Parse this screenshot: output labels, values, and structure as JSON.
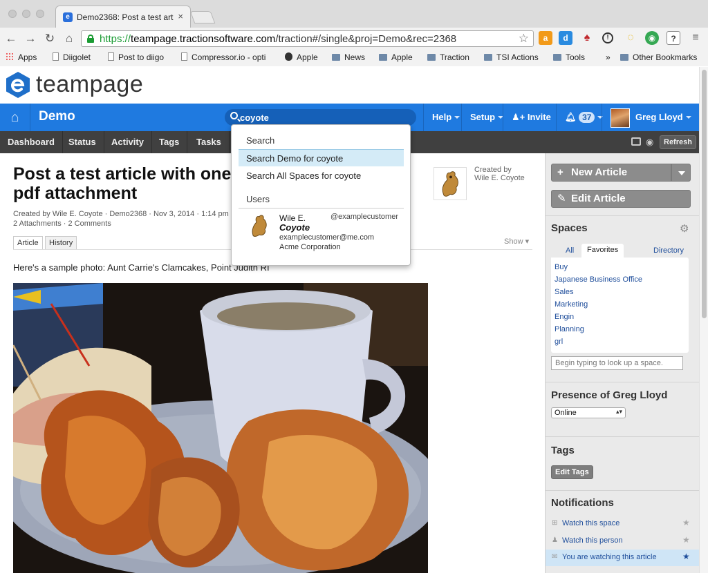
{
  "browser": {
    "tab_title": "Demo2368: Post a test artic",
    "tab_close": "×",
    "url_scheme": "https://",
    "url_host": "teampage.tractionsoftware.com",
    "url_path": "/traction#/single&proj=Demo&rec=2368",
    "bookmarks": [
      "Apps",
      "Diigolet",
      "Post to diigo",
      "Compressor.io - opti",
      "Apple",
      "News",
      "Apple",
      "Traction",
      "TSI Actions",
      "Tools"
    ],
    "bookmarks_overflow": "»",
    "other_bookmarks": "Other Bookmarks"
  },
  "app": {
    "logo_text": "teampage",
    "space_name": "Demo",
    "search_value": "coyote",
    "nav": {
      "help": "Help",
      "setup": "Setup",
      "invite": "Invite",
      "notification_count": "37",
      "user_name": "Greg Lloyd"
    },
    "tabs": [
      "Dashboard",
      "Status",
      "Activity",
      "Tags",
      "Tasks"
    ],
    "refresh_label": "Refresh"
  },
  "search_dropdown": {
    "search_header": "Search",
    "search_demo": "Search Demo for coyote",
    "search_all": "Search All Spaces for coyote",
    "users_header": "Users",
    "user": {
      "first": "Wile E.",
      "last": "Coyote",
      "handle": "@examplecustomer",
      "email": "examplecustomer@me.com",
      "company": "Acme Corporation"
    }
  },
  "article": {
    "title": "Post a test article with one ... pdf attachment",
    "title_line1": "Post a test article with one",
    "title_line2": "pdf attachment",
    "meta_line1": "Created by Wile E. Coyote · Demo2368 · Nov 3, 2014 · 1:14 pm",
    "meta_line2": "2 Attachments · 2 Comments",
    "tab_article": "Article",
    "tab_history": "History",
    "show_label": "Show",
    "created_by_label": "Created by",
    "created_by_name": "Wile E. Coyote",
    "body_text": "Here's a sample photo: Aunt Carrie's Clamcakes, Point Judith RI"
  },
  "sidebar": {
    "new_article": "New Article",
    "edit_article": "Edit Article",
    "spaces_title": "Spaces",
    "spaces_tabs": [
      "All",
      "Favorites",
      "Directory"
    ],
    "spaces_active_tab": "Favorites",
    "spaces": [
      "Buy",
      "Japanese Business Office",
      "Sales",
      "Marketing",
      "Engin",
      "Planning",
      "grl"
    ],
    "space_lookup_placeholder": "Begin typing to look up a space.",
    "presence_title": "Presence of Greg Lloyd",
    "presence_value": "Online",
    "tags_title": "Tags",
    "edit_tags": "Edit Tags",
    "notifications_title": "Notifications",
    "notifications": [
      {
        "label": "Watch this space",
        "active": false
      },
      {
        "label": "Watch this person",
        "active": false
      },
      {
        "label": "You are watching this article",
        "active": true
      }
    ]
  },
  "colors": {
    "brand_blue": "#1f7ae0",
    "nav_dark": "#404040",
    "link_blue": "#1f4e9b",
    "secure_green": "#1a9b33"
  }
}
